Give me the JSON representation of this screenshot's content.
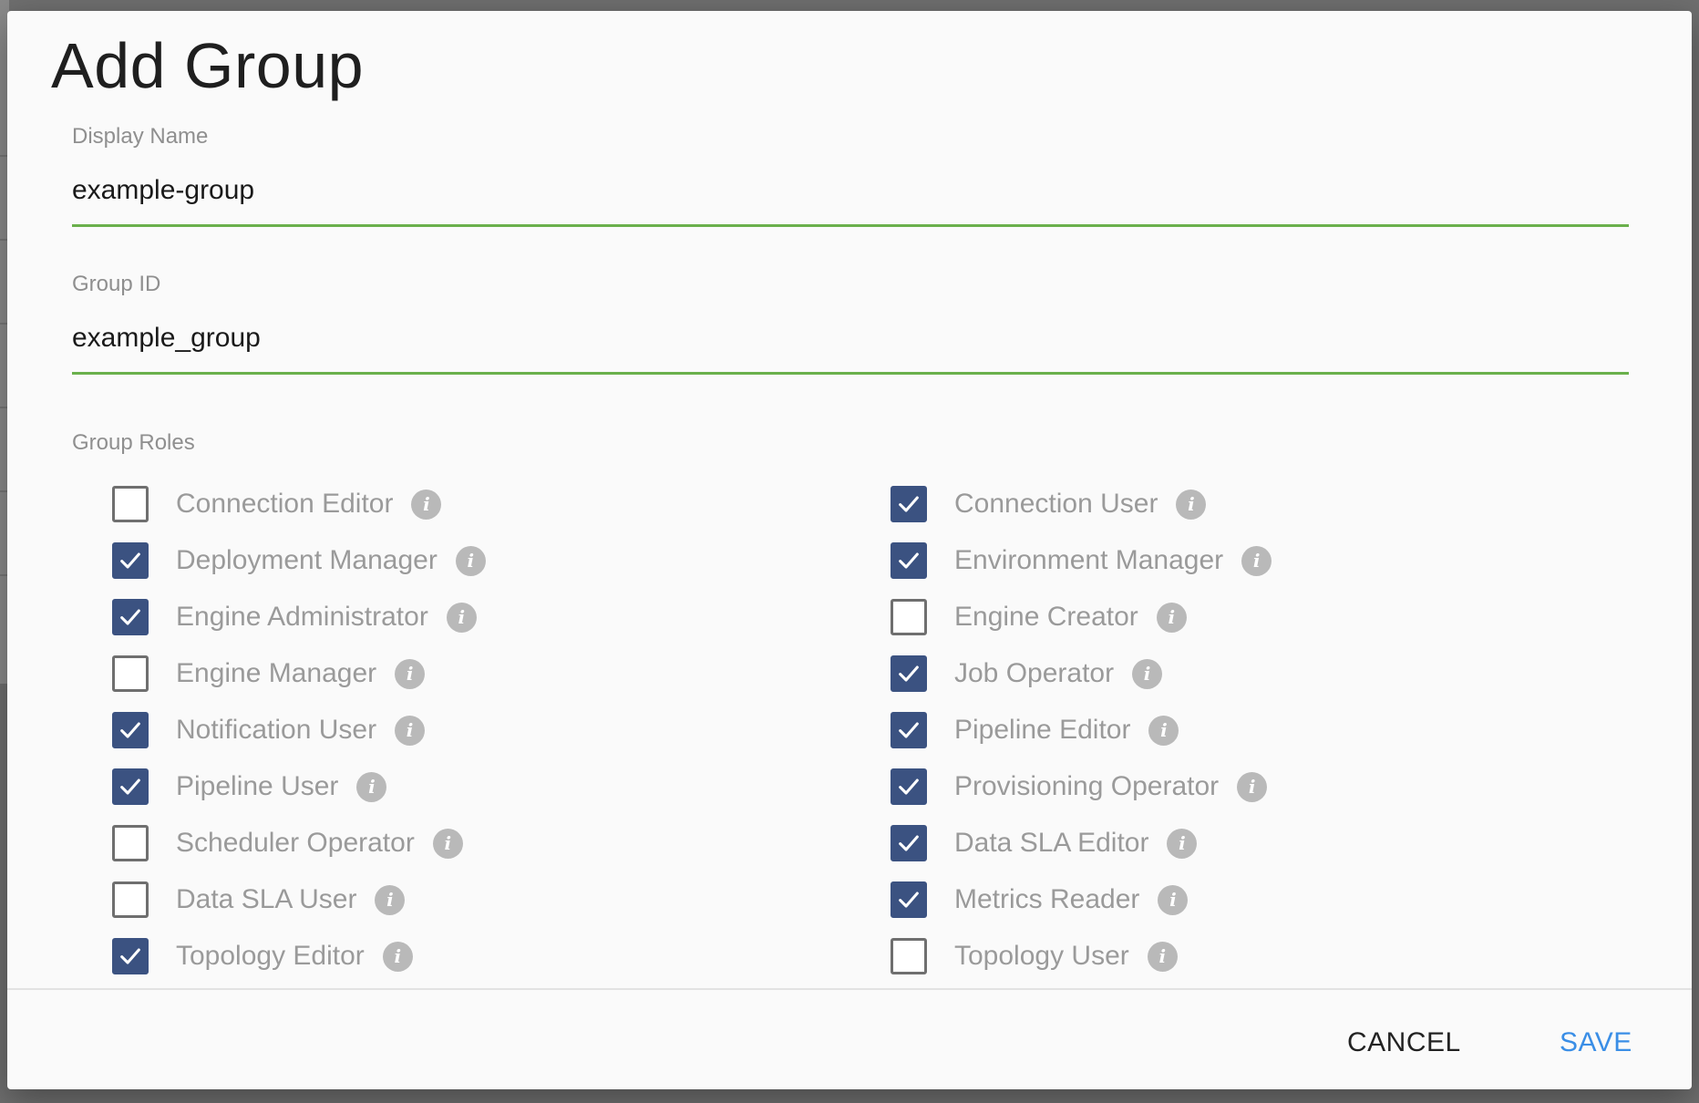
{
  "dialog": {
    "title": "Add Group",
    "display_name": {
      "label": "Display Name",
      "value": "example-group"
    },
    "group_id": {
      "label": "Group ID",
      "value": "example_group"
    },
    "roles_label": "Group Roles",
    "roles": [
      {
        "label": "Connection Editor",
        "checked": false
      },
      {
        "label": "Connection User",
        "checked": true
      },
      {
        "label": "Deployment Manager",
        "checked": true
      },
      {
        "label": "Environment Manager",
        "checked": true
      },
      {
        "label": "Engine Administrator",
        "checked": true
      },
      {
        "label": "Engine Creator",
        "checked": false
      },
      {
        "label": "Engine Manager",
        "checked": false
      },
      {
        "label": "Job Operator",
        "checked": true
      },
      {
        "label": "Notification User",
        "checked": true
      },
      {
        "label": "Pipeline Editor",
        "checked": true
      },
      {
        "label": "Pipeline User",
        "checked": true
      },
      {
        "label": "Provisioning Operator",
        "checked": true
      },
      {
        "label": "Scheduler Operator",
        "checked": false
      },
      {
        "label": "Data SLA Editor",
        "checked": true
      },
      {
        "label": "Data SLA User",
        "checked": false
      },
      {
        "label": "Metrics Reader",
        "checked": true
      },
      {
        "label": "Topology Editor",
        "checked": true
      },
      {
        "label": "Topology User",
        "checked": false
      }
    ],
    "cancel_label": "CANCEL",
    "save_label": "SAVE",
    "colors": {
      "checkbox_checked": "#3b5281",
      "input_underline": "#6ab04c",
      "save_button": "#3a8ee6"
    }
  }
}
